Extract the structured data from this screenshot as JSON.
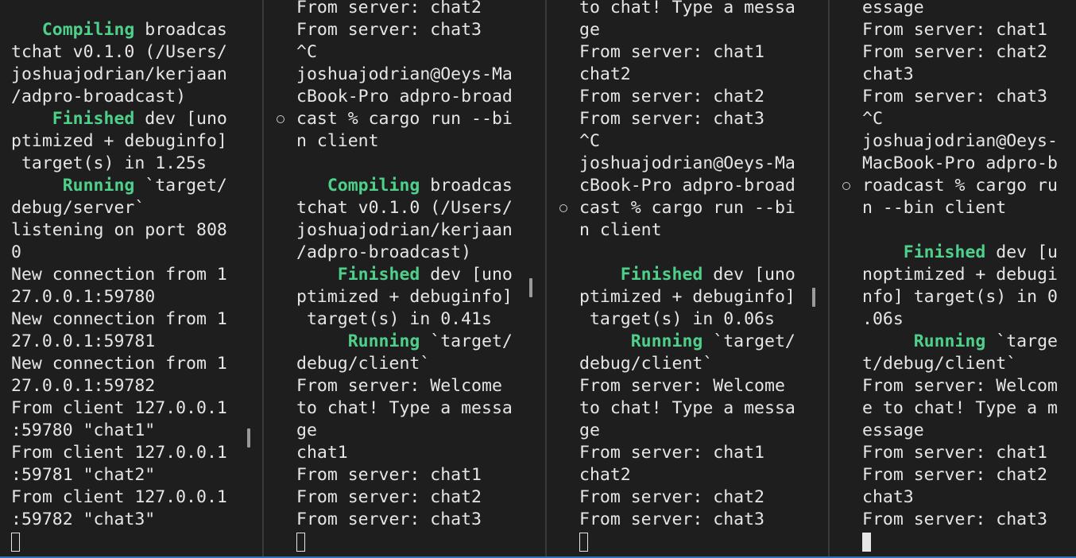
{
  "panes": [
    {
      "name": "server",
      "lines": [
        {
          "kw": "   Compiling",
          "text": " broadcas"
        },
        {
          "text": "tchat v0.1.0 (/Users/"
        },
        {
          "text": "joshuajodrian/kerjaan"
        },
        {
          "text": "/adpro-broadcast)"
        },
        {
          "kw": "    Finished",
          "text": " dev [uno"
        },
        {
          "text": "ptimized + debuginfo]"
        },
        {
          "text": " target(s) in 1.25s"
        },
        {
          "kw": "     Running",
          "text": " `target/"
        },
        {
          "text": "debug/server`"
        },
        {
          "text": "listening on port 808"
        },
        {
          "text": "0"
        },
        {
          "text": "New connection from 1"
        },
        {
          "text": "27.0.0.1:59780"
        },
        {
          "text": "New connection from 1"
        },
        {
          "text": "27.0.0.1:59781"
        },
        {
          "text": "New connection from 1"
        },
        {
          "text": "27.0.0.1:59782"
        },
        {
          "text": "From client 127.0.0.1"
        },
        {
          "text": ":59780 \"chat1\""
        },
        {
          "text": "From client 127.0.0.1"
        },
        {
          "text": ":59781 \"chat2\""
        },
        {
          "text": "From client 127.0.0.1"
        },
        {
          "text": ":59782 \"chat3\""
        }
      ]
    },
    {
      "name": "client-1",
      "lines": [
        {
          "text": "From server: chat2"
        },
        {
          "text": "From server: chat3"
        },
        {
          "text": "^C"
        },
        {
          "text": "joshuajodrian@Oeys-Ma"
        },
        {
          "text": "cBook-Pro adpro-broad"
        },
        {
          "text": "cast % cargo run --bi"
        },
        {
          "text": "n client"
        },
        {
          "text": ""
        },
        {
          "kw": "   Compiling",
          "text": " broadcas"
        },
        {
          "text": "tchat v0.1.0 (/Users/"
        },
        {
          "text": "joshuajodrian/kerjaan"
        },
        {
          "text": "/adpro-broadcast)"
        },
        {
          "kw": "    Finished",
          "text": " dev [uno"
        },
        {
          "text": "ptimized + debuginfo]"
        },
        {
          "text": " target(s) in 0.41s"
        },
        {
          "kw": "     Running",
          "text": " `target/"
        },
        {
          "text": "debug/client`"
        },
        {
          "text": "From server: Welcome"
        },
        {
          "text": "to chat! Type a messa"
        },
        {
          "text": "ge"
        },
        {
          "text": "chat1"
        },
        {
          "text": "From server: chat1"
        },
        {
          "text": "From server: chat2"
        },
        {
          "text": "From server: chat3"
        }
      ]
    },
    {
      "name": "client-2",
      "lines": [
        {
          "text": "to chat! Type a messa"
        },
        {
          "text": "ge"
        },
        {
          "text": "From server: chat1"
        },
        {
          "text": "chat2"
        },
        {
          "text": "From server: chat2"
        },
        {
          "text": "From server: chat3"
        },
        {
          "text": "^C"
        },
        {
          "text": "joshuajodrian@Oeys-Ma"
        },
        {
          "text": "cBook-Pro adpro-broad"
        },
        {
          "text": "cast % cargo run --bi"
        },
        {
          "text": "n client"
        },
        {
          "text": ""
        },
        {
          "kw": "    Finished",
          "text": " dev [uno"
        },
        {
          "text": "ptimized + debuginfo]"
        },
        {
          "text": " target(s) in 0.06s"
        },
        {
          "kw": "     Running",
          "text": " `target/"
        },
        {
          "text": "debug/client`"
        },
        {
          "text": "From server: Welcome"
        },
        {
          "text": "to chat! Type a messa"
        },
        {
          "text": "ge"
        },
        {
          "text": "From server: chat1"
        },
        {
          "text": "chat2"
        },
        {
          "text": "From server: chat2"
        },
        {
          "text": "From server: chat3"
        }
      ]
    },
    {
      "name": "client-3",
      "lines": [
        {
          "text": "essage"
        },
        {
          "text": "From server: chat1"
        },
        {
          "text": "From server: chat2"
        },
        {
          "text": "chat3"
        },
        {
          "text": "From server: chat3"
        },
        {
          "text": "^C"
        },
        {
          "text": "joshuajodrian@Oeys-"
        },
        {
          "text": "MacBook-Pro adpro-b"
        },
        {
          "text": "roadcast % cargo ru"
        },
        {
          "text": "n --bin client"
        },
        {
          "text": ""
        },
        {
          "kw": "    Finished",
          "text": " dev [u"
        },
        {
          "text": "noptimized + debugi"
        },
        {
          "text": "nfo] target(s) in 0"
        },
        {
          "text": ".06s"
        },
        {
          "kw": "     Running",
          "text": " `targe"
        },
        {
          "text": "t/debug/client`"
        },
        {
          "text": "From server: Welcom"
        },
        {
          "text": "e to chat! Type a m"
        },
        {
          "text": "essage"
        },
        {
          "text": "From server: chat1"
        },
        {
          "text": "From server: chat2"
        },
        {
          "text": "chat3"
        },
        {
          "text": "From server: chat3"
        }
      ]
    }
  ],
  "colors": {
    "background": "#1e1e1e",
    "text": "#e6e6e6",
    "keyword": "#4fd08a",
    "divider": "#3a3a3a",
    "accent": "#2f6fb3"
  }
}
